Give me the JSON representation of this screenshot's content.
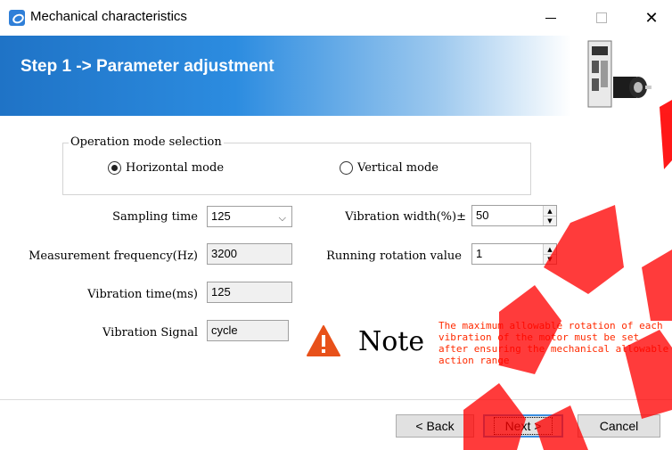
{
  "window": {
    "title": "Mechanical characteristics",
    "minimize_glyph": "—",
    "maximize_glyph": "□",
    "close_glyph": "✕"
  },
  "banner": {
    "title": "Step 1 -> Parameter adjustment",
    "image": "servo-drive-and-motor"
  },
  "operation_mode": {
    "legend": "Operation mode selection",
    "options": [
      {
        "label": "Horizontal mode",
        "selected": true
      },
      {
        "label": "Vertical mode",
        "selected": false
      }
    ]
  },
  "params": {
    "sampling_time": {
      "label": "Sampling time",
      "value": "125"
    },
    "measurement_frequency": {
      "label": "Measurement frequency(Hz)",
      "value": "3200"
    },
    "vibration_time": {
      "label": "Vibration time(ms)",
      "value": "125"
    },
    "vibration_signal": {
      "label": "Vibration Signal",
      "value": "cycle"
    },
    "vibration_width": {
      "label": "Vibration width(%)±",
      "value": "50"
    },
    "running_rotation": {
      "label": "Running rotation value",
      "value": "1"
    }
  },
  "note": {
    "title": "Note",
    "text": "The maximum allowable rotation of each vibration of the motor must be set after ensuring the mechanical allowable action range",
    "color": "#ff2a00"
  },
  "buttons": {
    "back": "< Back",
    "next": "Next >",
    "cancel": "Cancel"
  },
  "colors": {
    "banner_blue": "#1f73c6",
    "watermark_red": "#ff0000"
  }
}
